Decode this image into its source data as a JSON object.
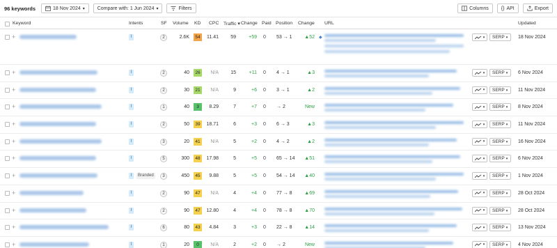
{
  "toolbar": {
    "keyword_count": "96 keywords",
    "date_label": "18 Nov 2024",
    "compare_label": "Compare with: 1 Jun 2024",
    "filters_label": "Filters",
    "columns_label": "Columns",
    "api_label": "API",
    "export_label": "Export"
  },
  "headers": {
    "keyword": "Keyword",
    "intents": "Intents",
    "sf": "SF",
    "volume": "Volume",
    "kd": "KD",
    "cpc": "CPC",
    "traffic": "Traffic ▾",
    "change": "Change",
    "paid": "Paid",
    "position": "Position",
    "change2": "Change",
    "url": "URL",
    "updated": "Updated"
  },
  "kd_colors": {
    "green_dark": "#57c26a",
    "green": "#a6d96a",
    "yellow": "#f5d14d",
    "orange": "#f4a54c"
  },
  "rows": [
    {
      "intent": "I",
      "branded": "",
      "sf": "2",
      "volume": "2.6K",
      "kd": "54",
      "kd_color": "#f4a54c",
      "cpc": "11.41",
      "traffic": "59",
      "change": "+59",
      "paid": "0",
      "pos": "53 → 1",
      "chg2": "▲52",
      "updated": "18 Nov 2024"
    },
    {
      "intent": "I",
      "branded": "",
      "sf": "2",
      "volume": "40",
      "kd": "26",
      "kd_color": "#a6d96a",
      "cpc": "N/A",
      "traffic": "15",
      "change": "+11",
      "paid": "0",
      "pos": "4 → 1",
      "chg2": "▲3",
      "updated": "6 Nov 2024"
    },
    {
      "intent": "I",
      "branded": "",
      "sf": "2",
      "volume": "30",
      "kd": "21",
      "kd_color": "#a6d96a",
      "cpc": "N/A",
      "traffic": "9",
      "change": "+6",
      "paid": "0",
      "pos": "3 → 1",
      "chg2": "▲2",
      "updated": "11 Nov 2024"
    },
    {
      "intent": "I",
      "branded": "",
      "sf": "1",
      "volume": "40",
      "kd": "3",
      "kd_color": "#57c26a",
      "cpc": "8.29",
      "traffic": "7",
      "change": "+7",
      "paid": "0",
      "pos": "→ 2",
      "chg2": "New",
      "updated": "8 Nov 2024"
    },
    {
      "intent": "I",
      "branded": "",
      "sf": "2",
      "volume": "50",
      "kd": "39",
      "kd_color": "#f5d14d",
      "cpc": "18.71",
      "traffic": "6",
      "change": "+3",
      "paid": "0",
      "pos": "6 → 3",
      "chg2": "▲3",
      "updated": "11 Nov 2024"
    },
    {
      "intent": "I",
      "branded": "",
      "sf": "3",
      "volume": "20",
      "kd": "41",
      "kd_color": "#f5d14d",
      "cpc": "N/A",
      "traffic": "5",
      "change": "+2",
      "paid": "0",
      "pos": "4 → 2",
      "chg2": "▲2",
      "updated": "16 Nov 2024"
    },
    {
      "intent": "I",
      "branded": "",
      "sf": "5",
      "volume": "300",
      "kd": "48",
      "kd_color": "#f5d14d",
      "cpc": "17.98",
      "traffic": "5",
      "change": "+5",
      "paid": "0",
      "pos": "65 → 14",
      "chg2": "▲51",
      "updated": "6 Nov 2024"
    },
    {
      "intent": "I",
      "branded": "Branded",
      "sf": "3",
      "volume": "450",
      "kd": "45",
      "kd_color": "#f5d14d",
      "cpc": "9.88",
      "traffic": "5",
      "change": "+5",
      "paid": "0",
      "pos": "54 → 14",
      "chg2": "▲40",
      "updated": "1 Nov 2024"
    },
    {
      "intent": "I",
      "branded": "",
      "sf": "2",
      "volume": "90",
      "kd": "47",
      "kd_color": "#f5d14d",
      "cpc": "N/A",
      "traffic": "4",
      "change": "+4",
      "paid": "0",
      "pos": "77 → 8",
      "chg2": "▲69",
      "updated": "28 Oct 2024"
    },
    {
      "intent": "I",
      "branded": "",
      "sf": "2",
      "volume": "90",
      "kd": "47",
      "kd_color": "#f5d14d",
      "cpc": "12.80",
      "traffic": "4",
      "change": "+4",
      "paid": "0",
      "pos": "78 → 8",
      "chg2": "▲70",
      "updated": "28 Oct 2024"
    },
    {
      "intent": "I",
      "branded": "",
      "sf": "6",
      "volume": "80",
      "kd": "43",
      "kd_color": "#f5d14d",
      "cpc": "4.84",
      "traffic": "3",
      "change": "+3",
      "paid": "0",
      "pos": "22 → 8",
      "chg2": "▲14",
      "updated": "13 Nov 2024"
    },
    {
      "intent": "I",
      "branded": "",
      "sf": "1",
      "volume": "20",
      "kd": "0",
      "kd_color": "#57c26a",
      "cpc": "N/A",
      "traffic": "2",
      "change": "+2",
      "paid": "0",
      "pos": "→ 2",
      "chg2": "New",
      "updated": "4 Nov 2024"
    }
  ],
  "serp_label": "SERP"
}
